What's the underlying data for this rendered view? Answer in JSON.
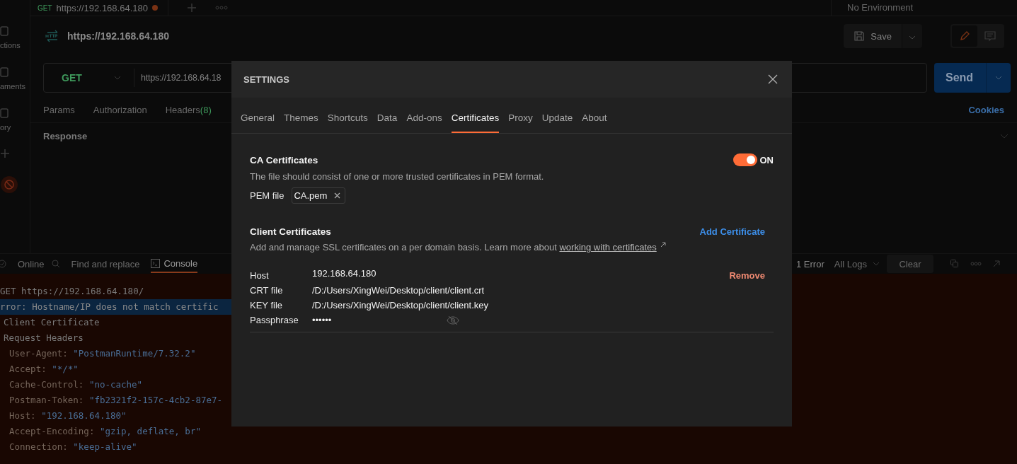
{
  "sidebar": {
    "items": [
      {
        "label": "ctions"
      },
      {
        "label": "aments"
      },
      {
        "label": "ory"
      }
    ]
  },
  "tab_bar": {
    "method": "GET",
    "title": "https://192.168.64.180",
    "unsaved": true,
    "environment": "No Environment"
  },
  "request": {
    "title": "https://192.168.64.180",
    "save": "Save",
    "method": "GET",
    "url": "https://192.168.64.18",
    "send": "Send",
    "tabs": [
      {
        "label": "Params"
      },
      {
        "label": "Authorization"
      },
      {
        "label": "Headers",
        "count": "(8)"
      }
    ],
    "cookies": "Cookies",
    "response": "Response"
  },
  "status_bar": {
    "online": "Online",
    "find": "Find and replace",
    "console": "Console",
    "console_selected": true,
    "errors": "1 Error",
    "logs": "All Logs",
    "clear": "Clear"
  },
  "console": {
    "lines": [
      {
        "kind": "request",
        "text": "GET https://192.168.64.180/"
      },
      {
        "kind": "error",
        "text": "rror: Hostname/IP does not match certific"
      },
      {
        "kind": "section",
        "text": "Client Certificate"
      },
      {
        "kind": "section",
        "text": "Request Headers"
      },
      {
        "kind": "header",
        "key": "User-Agent: ",
        "value": "\"PostmanRuntime/7.32.2\""
      },
      {
        "kind": "header",
        "key": "Accept: ",
        "value": "\"*/*\""
      },
      {
        "kind": "header",
        "key": "Cache-Control: ",
        "value": "\"no-cache\""
      },
      {
        "kind": "header",
        "key": "Postman-Token: ",
        "value": "\"fb2321f2-157c-4cb2-87e7-"
      },
      {
        "kind": "header",
        "key": "Host: ",
        "value": "\"192.168.64.180\""
      },
      {
        "kind": "header",
        "key": "Accept-Encoding: ",
        "value": "\"gzip, deflate, br\""
      },
      {
        "kind": "header",
        "key": "Connection: ",
        "value": "\"keep-alive\""
      }
    ]
  },
  "settings": {
    "title": "SETTINGS",
    "tabs": [
      {
        "label": "General",
        "selected": false
      },
      {
        "label": "Themes",
        "selected": false
      },
      {
        "label": "Shortcuts",
        "selected": false
      },
      {
        "label": "Data",
        "selected": false
      },
      {
        "label": "Add-ons",
        "selected": false
      },
      {
        "label": "Certificates",
        "selected": true
      },
      {
        "label": "Proxy",
        "selected": false
      },
      {
        "label": "Update",
        "selected": false
      },
      {
        "label": "About",
        "selected": false
      }
    ],
    "ca": {
      "title": "CA Certificates",
      "enabled": true,
      "toggle_label": "ON",
      "description": "The file should consist of one or more trusted certificates in PEM format.",
      "pem_label": "PEM file",
      "pem_file": "CA.pem"
    },
    "client": {
      "title": "Client Certificates",
      "add": "Add Certificate",
      "description": "Add and manage SSL certificates on a per domain basis. Learn more about ",
      "link": "working with certificates",
      "entries": [
        {
          "host_label": "Host",
          "host": "192.168.64.180",
          "remove": "Remove",
          "crt_label": "CRT file",
          "crt": "/D:/Users/XingWei/Desktop/client/client.crt",
          "key_label": "KEY file",
          "key": "/D:/Users/XingWei/Desktop/client/client.key",
          "pass_label": "Passphrase",
          "passphrase": "••••••"
        }
      ]
    }
  }
}
